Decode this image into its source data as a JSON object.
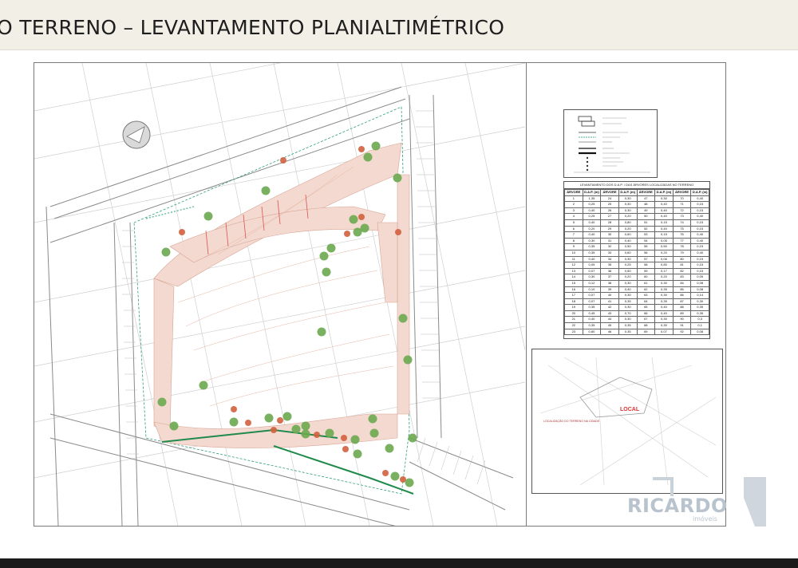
{
  "title": "O TERRENO – LEVANTAMENTO PLANIALTIMÉTRICO",
  "table": {
    "title": "LEVANTAMENTO DOS D.A.P. \\ DAS ÁRVORES LOCALIZADAS NO TERRENO",
    "headers": [
      "ÁRVORE",
      "D.A.P. (m)",
      "ÁRVORE",
      "D.A.P. (m)",
      "ÁRVORE",
      "D.A.P. (m)",
      "ÁRVORE",
      "D.A.P. (m)"
    ],
    "rows": [
      [
        "1",
        "1,35",
        "24",
        "0,30",
        "47",
        "0,30",
        "70",
        "0,40"
      ],
      [
        "2",
        "0,25",
        "25",
        "0,30",
        "48",
        "0,40",
        "71",
        "0,15"
      ],
      [
        "3",
        "0,40",
        "26",
        "0,30",
        "49",
        "0,40",
        "72",
        "0,15"
      ],
      [
        "4",
        "0,25",
        "27",
        "0,20",
        "50",
        "0,40",
        "73",
        "0,40"
      ],
      [
        "5",
        "0,40",
        "28",
        "0,80",
        "51",
        "0,15",
        "74",
        "0,15"
      ],
      [
        "6",
        "0,20",
        "29",
        "0,20",
        "52",
        "0,40",
        "75",
        "0,15"
      ],
      [
        "7",
        "0,40",
        "30",
        "0,60",
        "53",
        "0,15",
        "76",
        "0,40"
      ],
      [
        "8",
        "0,30",
        "31",
        "0,40",
        "54",
        "0,05",
        "77",
        "0,40"
      ],
      [
        "9",
        "0,35",
        "32",
        "0,50",
        "55",
        "0,50",
        "78",
        "0,15"
      ],
      [
        "10",
        "0,35",
        "33",
        "0,60",
        "56",
        "0,20",
        "79",
        "0,40"
      ],
      [
        "11",
        "0,40",
        "34",
        "0,30",
        "57",
        "0,06",
        "80",
        "0,15"
      ],
      [
        "12",
        "0,05",
        "35",
        "0,25",
        "58",
        "0,80",
        "81",
        "0,15"
      ],
      [
        "13",
        "0,07",
        "36",
        "0,50",
        "59",
        "0,17",
        "82",
        "0,15"
      ],
      [
        "14",
        "0,30",
        "37",
        "0,20",
        "60",
        "0,20",
        "83",
        "0,05"
      ],
      [
        "15",
        "0,12",
        "38",
        "0,30",
        "61",
        "0,30",
        "84",
        "0,08"
      ],
      [
        "16",
        "0,10",
        "39",
        "0,40",
        "62",
        "0,35",
        "85",
        "0,08"
      ],
      [
        "17",
        "0,07",
        "40",
        "0,30",
        "63",
        "0,30",
        "86",
        "0,14"
      ],
      [
        "18",
        "0,07",
        "41",
        "0,35",
        "64",
        "0,35",
        "87",
        "0,30"
      ],
      [
        "19",
        "0,35",
        "42",
        "0,30",
        "65",
        "0,40",
        "88",
        "0,35"
      ],
      [
        "20",
        "0,45",
        "43",
        "0,70",
        "66",
        "0,40",
        "89",
        "0,35"
      ],
      [
        "21",
        "0,40",
        "44",
        "0,30",
        "67",
        "0,30",
        "90",
        "0,3"
      ],
      [
        "22",
        "0,35",
        "45",
        "0,35",
        "68",
        "0,30",
        "91",
        "0,1"
      ],
      [
        "23",
        "0,80",
        "46",
        "0,35",
        "69",
        "0,07",
        "92",
        "0,08"
      ]
    ]
  },
  "location": {
    "label": "LOCAL",
    "text": "LOCALIZAÇÃO DO TERRENO NA CIDADE"
  },
  "logo": {
    "name": "RICARDO",
    "sub": "imóveis"
  },
  "colors": {
    "tree_green": "#6aa84f",
    "tree_red": "#d1603d",
    "slope_fill": "#f3d9cf",
    "hedge": "#1f8a4c"
  }
}
